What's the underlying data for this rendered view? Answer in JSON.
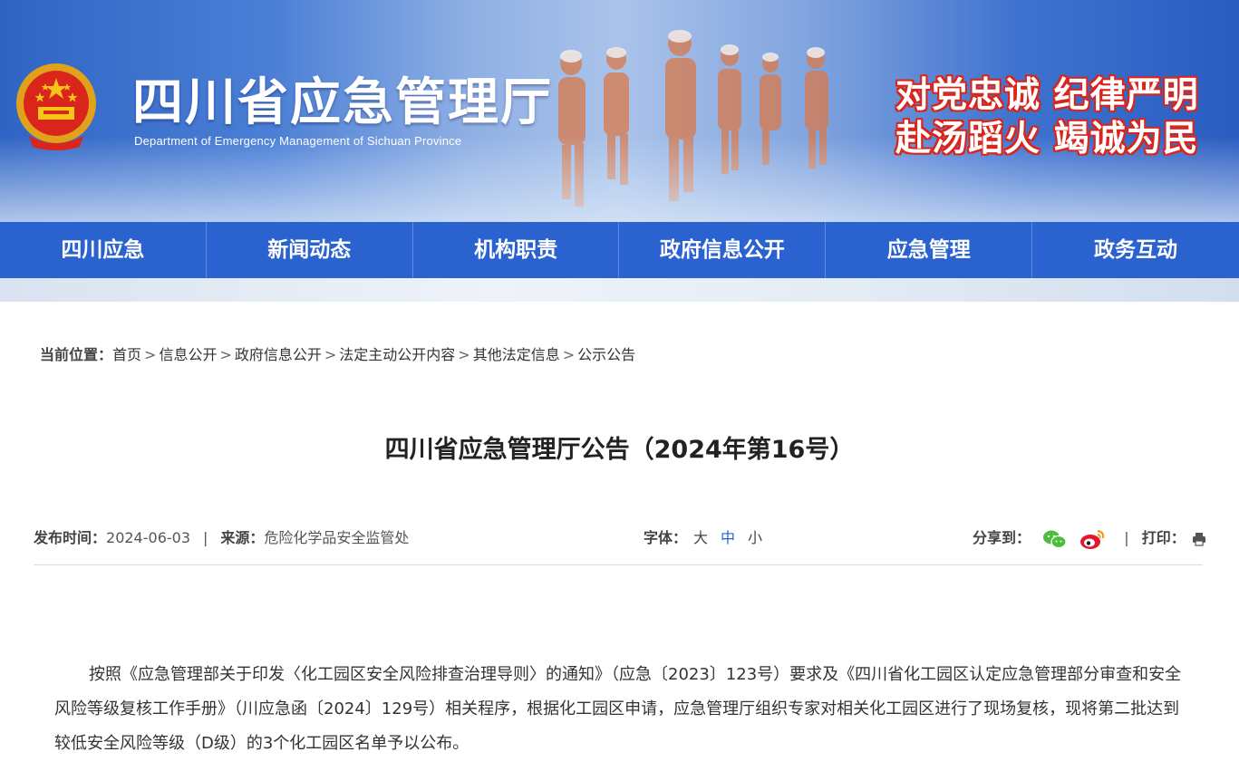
{
  "header": {
    "site_title": "四川省应急管理厅",
    "site_subtitle": "Department of Emergency Management of Sichuan Province",
    "slogan_line1": "对党忠诚 纪律严明",
    "slogan_line2": "赴汤蹈火 竭诚为民",
    "emblem_icon": "national-emblem-icon",
    "colors": {
      "banner": "#2f64c4",
      "slogan_outline": "#d9251b"
    }
  },
  "nav": {
    "items": [
      "四川应急",
      "新闻动态",
      "机构职责",
      "政府信息公开",
      "应急管理",
      "政务互动"
    ],
    "color": "#2a62cf"
  },
  "breadcrumb": {
    "label": "当前位置：",
    "items": [
      "首页",
      "信息公开",
      "政府信息公开",
      "法定主动公开内容",
      "其他法定信息",
      "公示公告"
    ],
    "separator": ">"
  },
  "article": {
    "title": "四川省应急管理厅公告（2024年第16号）",
    "publish_label": "发布时间：",
    "publish_date": "2024-06-03",
    "source_label": "来源：",
    "source": "危险化学品安全监管处",
    "font_label": "字体：",
    "font_sizes": [
      "大",
      "中",
      "小"
    ],
    "font_active": "中",
    "share_label": "分享到：",
    "share_icons": [
      "wechat-icon",
      "weibo-icon"
    ],
    "print_label": "打印：",
    "print_icon": "printer-icon",
    "divider": "|",
    "body": "按照《应急管理部关于印发〈化工园区安全风险排查治理导则〉的通知》（应急〔2023〕123号）要求及《四川省化工园区认定应急管理部分审查和安全风险等级复核工作手册》（川应急函〔2024〕129号）相关程序，根据化工园区申请，应急管理厅组织专家对相关化工园区进行了现场复核，现将第二批达到较低安全风险等级（D级）的3个化工园区名单予以公布。"
  }
}
